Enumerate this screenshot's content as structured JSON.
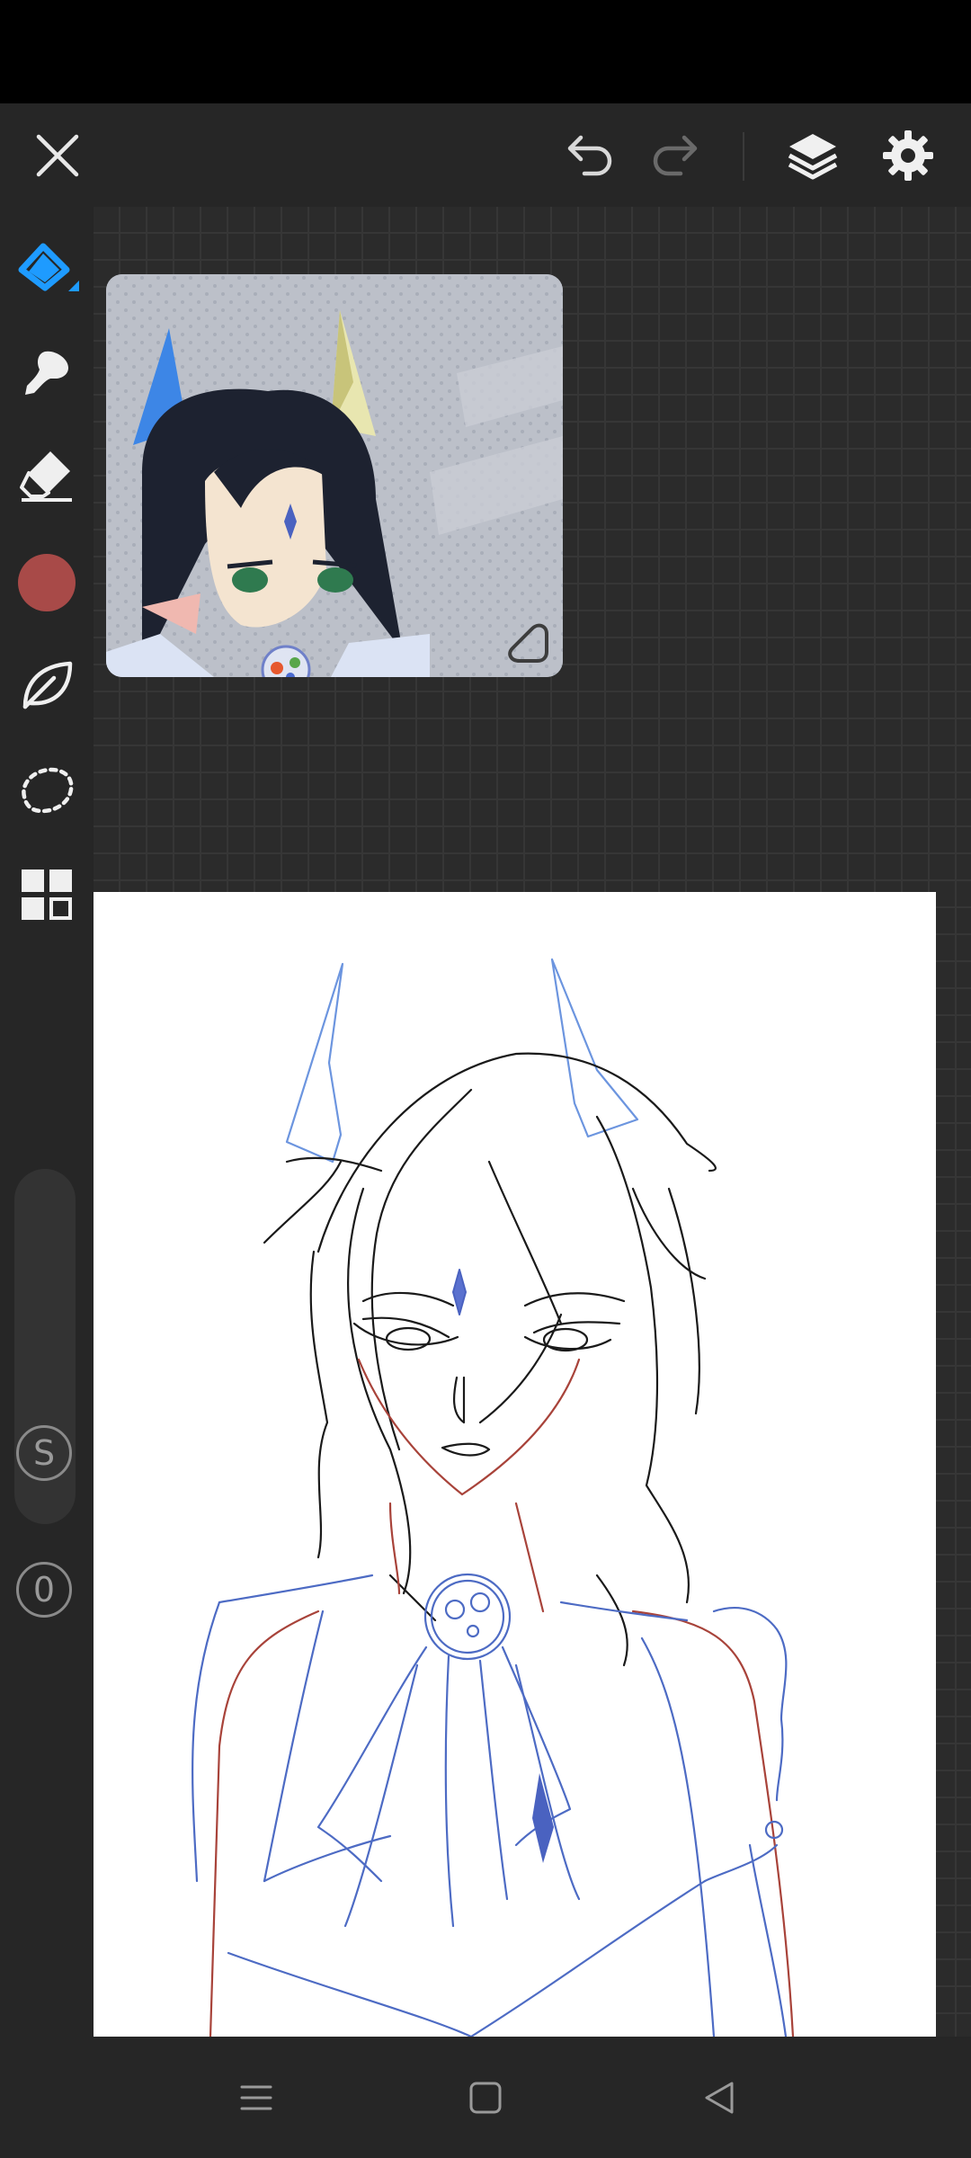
{
  "app": {
    "name": "drawing-canvas"
  },
  "toolbar": {
    "close": "close",
    "undo": "undo",
    "redo": "redo",
    "layers": "layers",
    "settings": "settings"
  },
  "sidebar": {
    "tools": [
      {
        "name": "brush",
        "icon": "pen-nib-icon",
        "selected": true
      },
      {
        "name": "smudge",
        "icon": "smudge-icon"
      },
      {
        "name": "eraser",
        "icon": "eraser-icon"
      },
      {
        "name": "color",
        "icon": "color-swatch",
        "color": "#a84a48"
      },
      {
        "name": "leaf",
        "icon": "leaf-icon"
      },
      {
        "name": "lasso",
        "icon": "lasso-icon"
      },
      {
        "name": "gallery",
        "icon": "grid-icon"
      }
    ],
    "size_label": "S",
    "opacity_label": "0"
  },
  "colors": {
    "accent": "#1e9bff",
    "panel": "#262626",
    "canvas_bg": "#2b2b2b",
    "current_color": "#a84a48",
    "line_blue": "#4d6bc4",
    "line_red": "#a8433a"
  },
  "navbar": {
    "menu": "menu-icon",
    "home": "home-icon",
    "back": "back-icon"
  }
}
